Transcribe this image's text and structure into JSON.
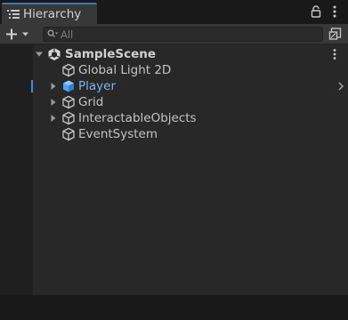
{
  "window": {
    "tab_title": "Hierarchy"
  },
  "toolbar": {
    "search": {
      "placeholder": "All"
    }
  },
  "tree": {
    "scene": {
      "label": "SampleScene",
      "expanded": true
    },
    "items": [
      {
        "label": "Global Light 2D",
        "has_children": false,
        "selected": false,
        "icon": "gameobject-cube-outline-icon"
      },
      {
        "label": "Player",
        "has_children": true,
        "selected": true,
        "icon": "prefab-cube-blue-icon"
      },
      {
        "label": "Grid",
        "has_children": true,
        "selected": false,
        "icon": "gameobject-cube-outline-icon"
      },
      {
        "label": "InteractableObjects",
        "has_children": true,
        "selected": false,
        "icon": "gameobject-cube-outline-icon"
      },
      {
        "label": "EventSystem",
        "has_children": false,
        "selected": false,
        "icon": "gameobject-cube-outline-icon"
      }
    ]
  },
  "colors": {
    "selected_text": "#7cb2ef",
    "selection_marker": "#3d8fe0",
    "tab_accent": "#3a79bb",
    "prefab_blue": "#4fa3ef"
  }
}
